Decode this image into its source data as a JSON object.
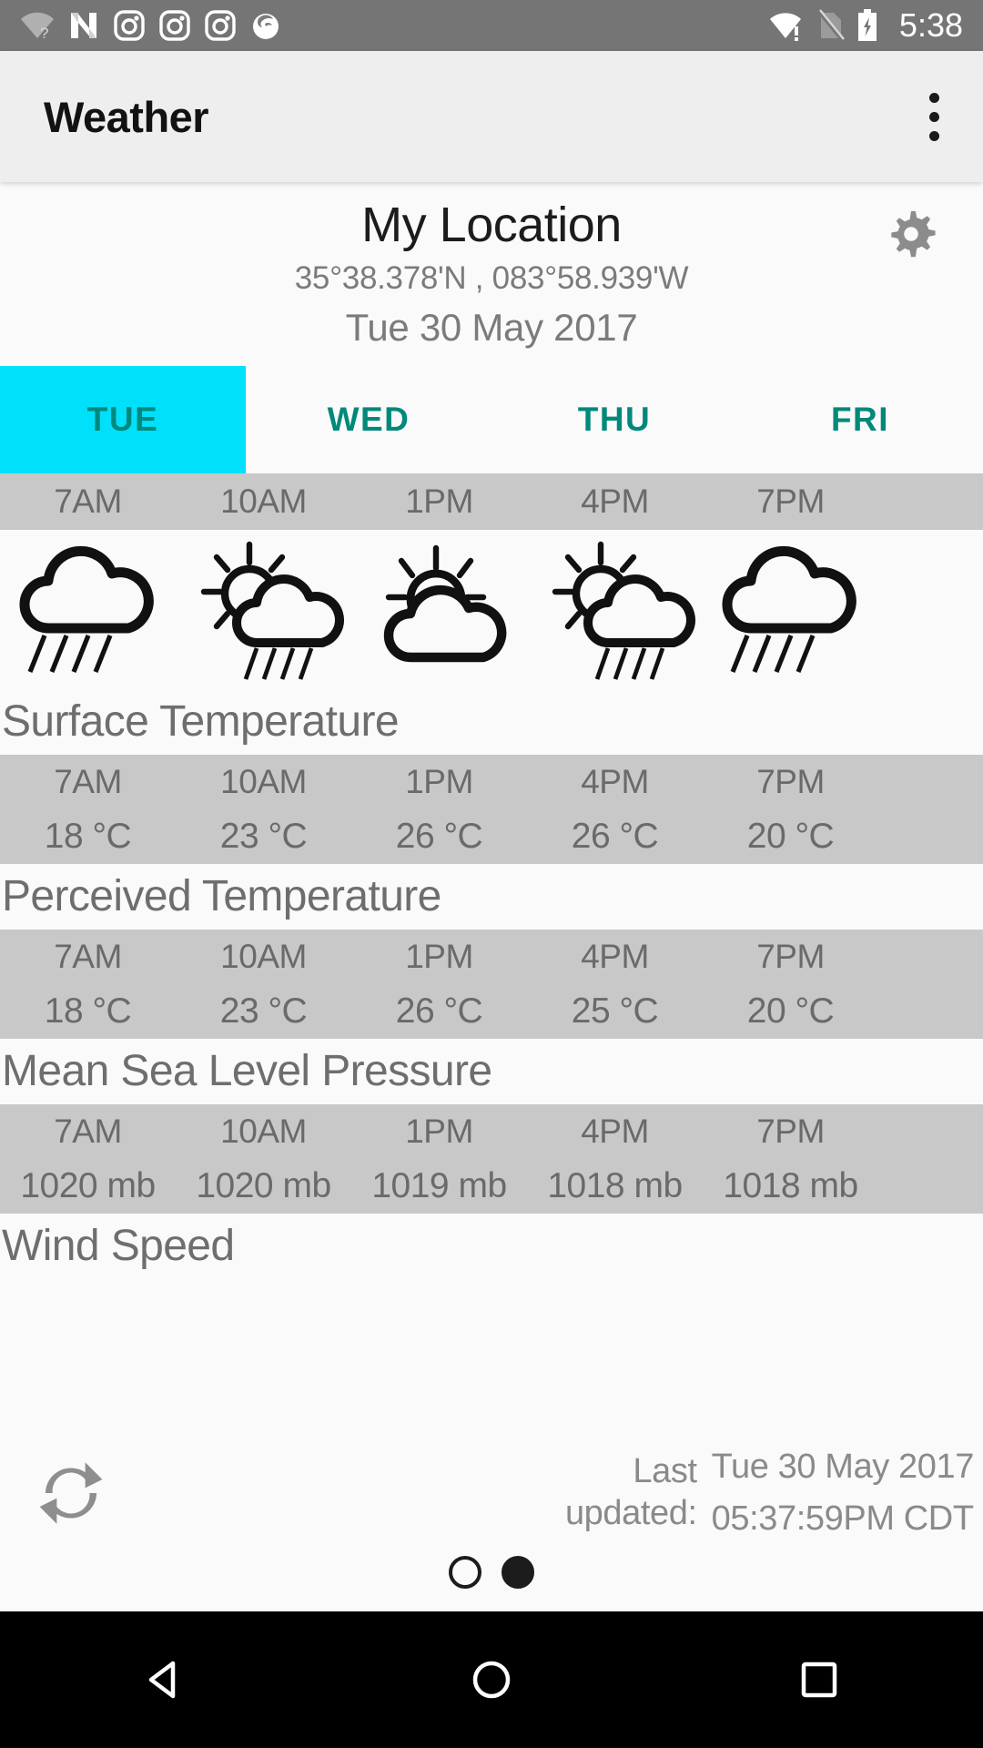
{
  "statusbar": {
    "time": "5:38",
    "left_icons": [
      "wifi-question-icon",
      "android-n-icon",
      "instagram-icon",
      "instagram-icon",
      "instagram-icon",
      "firefox-icon"
    ],
    "right_icons": [
      "wifi-alert-icon",
      "no-sim-icon",
      "battery-charging-icon"
    ]
  },
  "appbar": {
    "title": "Weather",
    "overflow_label": "More options"
  },
  "location": {
    "name": "My Location",
    "coords": "35°38.378'N , 083°58.939'W",
    "date": "Tue 30 May 2017",
    "settings_icon": "gear-icon"
  },
  "tabs": [
    {
      "label": "TUE",
      "active": true
    },
    {
      "label": "WED",
      "active": false
    },
    {
      "label": "THU",
      "active": false
    },
    {
      "label": "FRI",
      "active": false
    }
  ],
  "hours": [
    "7AM",
    "10AM",
    "1PM",
    "4PM",
    "7PM"
  ],
  "conditions": [
    "rain",
    "sun-cloud-rain",
    "sun-cloud",
    "sun-cloud-rain",
    "rain"
  ],
  "sections": [
    {
      "title": "Surface Temperature",
      "hours": [
        "7AM",
        "10AM",
        "1PM",
        "4PM",
        "7PM"
      ],
      "values": [
        "18 °C",
        "23 °C",
        "26 °C",
        "26 °C",
        "20 °C"
      ]
    },
    {
      "title": "Perceived Temperature",
      "hours": [
        "7AM",
        "10AM",
        "1PM",
        "4PM",
        "7PM"
      ],
      "values": [
        "18 °C",
        "23 °C",
        "26 °C",
        "25 °C",
        "20 °C"
      ]
    },
    {
      "title": "Mean Sea Level Pressure",
      "hours": [
        "7AM",
        "10AM",
        "1PM",
        "4PM",
        "7PM"
      ],
      "values": [
        "1020 mb",
        "1020 mb",
        "1019 mb",
        "1018 mb",
        "1018 mb"
      ]
    },
    {
      "title": "Wind Speed",
      "hours": [],
      "values": []
    }
  ],
  "footer": {
    "refresh_icon": "refresh-icon",
    "last_updated_label": "Last updated:",
    "last_updated_date": "Tue 30 May 2017",
    "last_updated_time": "05:37:59PM CDT",
    "pager": [
      {
        "filled": false
      },
      {
        "filled": true
      }
    ]
  },
  "navbar": {
    "back": "back-triangle-icon",
    "home": "home-circle-icon",
    "recents": "recents-square-icon"
  },
  "colors": {
    "accent_cyan": "#00e0fa",
    "tab_teal": "#00897b",
    "statusbar_gray": "#757575",
    "appbar_gray": "#eeeeee",
    "row_gray": "#c8c8c8",
    "page_bg": "#fafafa"
  }
}
